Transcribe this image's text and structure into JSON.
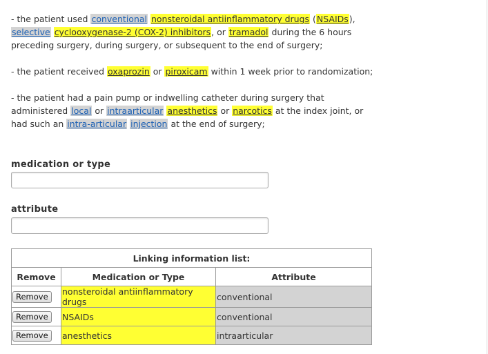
{
  "para1": {
    "p1": "- the patient used ",
    "conventional": "conventional",
    "s1": " ",
    "nsaid_drugs": "nonsteroidal antiinflammatory drugs",
    "s2": " (",
    "nsaids": "NSAIDs",
    "s3": "), ",
    "selective": "selective",
    "s4": " ",
    "cox2": "cyclooxygenase-2 (COX-2) inhibitors",
    "s5": ", or ",
    "tramadol": "tramadol",
    "s6": " during the 6 hours preceding surgery, during surgery, or subsequent to the end of surgery;"
  },
  "para2": {
    "p1": "- the patient received ",
    "oxaprozin": "oxaprozin",
    "s1": " or ",
    "piroxicam": "piroxicam",
    "s2": " within 1 week prior to randomization;"
  },
  "para3": {
    "p1": "- the patient had a pain pump or indwelling catheter during surgery that administered ",
    "local": "local",
    "s1": " or ",
    "intraarticular": "intraarticular",
    "s2": " ",
    "anesthetics": "anesthetics",
    "s3": " or ",
    "narcotics": "narcotics",
    "s4": " at the index joint, or had such an ",
    "intra_articular": "intra-articular",
    "s5": " ",
    "injection": "injection",
    "s6": " at the end of surgery;"
  },
  "form": {
    "medication_label": "medication or type",
    "medication_value": "",
    "attribute_label": "attribute",
    "attribute_value": ""
  },
  "linking": {
    "title": "Linking information list:",
    "headers": {
      "remove": "Remove",
      "medication": "Medication or Type",
      "attribute": "Attribute"
    },
    "rows": [
      {
        "button": "Remove",
        "medication": "nonsteroidal antiinflammatory drugs",
        "attribute": "conventional"
      },
      {
        "button": "Remove",
        "medication": "NSAIDs",
        "attribute": "conventional"
      },
      {
        "button": "Remove",
        "medication": "anesthetics",
        "attribute": "intraarticular"
      }
    ]
  },
  "colors": {
    "highlight_medication": "#ffff33",
    "highlight_attribute": "#d3d3d3",
    "link_text": "#1a5fb4"
  }
}
